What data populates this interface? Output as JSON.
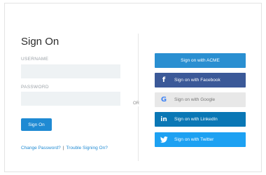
{
  "login": {
    "title": "Sign On",
    "username_label": "USERNAME",
    "username_value": "",
    "password_label": "PASSWORD",
    "password_value": "",
    "signon_button": "Sign On",
    "change_password_link": "Change Password?",
    "separator": "|",
    "trouble_link": "Trouble Signing On?"
  },
  "divider": {
    "or_label": "OR"
  },
  "sso": {
    "acme": {
      "label": "Sign on with ACME",
      "color": "#2a8fd1"
    },
    "facebook": {
      "label": "Sign on with Facebook",
      "icon": "facebook-icon",
      "color": "#3b5998"
    },
    "google": {
      "label": "Sign on with Google",
      "icon": "google-icon",
      "color": "#e8e8e8"
    },
    "linkedin": {
      "label": "Sign on with LinkedIn",
      "icon": "linkedin-icon",
      "color": "#0a77b5"
    },
    "twitter": {
      "label": "Sign on with Twitter",
      "icon": "twitter-icon",
      "color": "#1da1f2"
    }
  }
}
